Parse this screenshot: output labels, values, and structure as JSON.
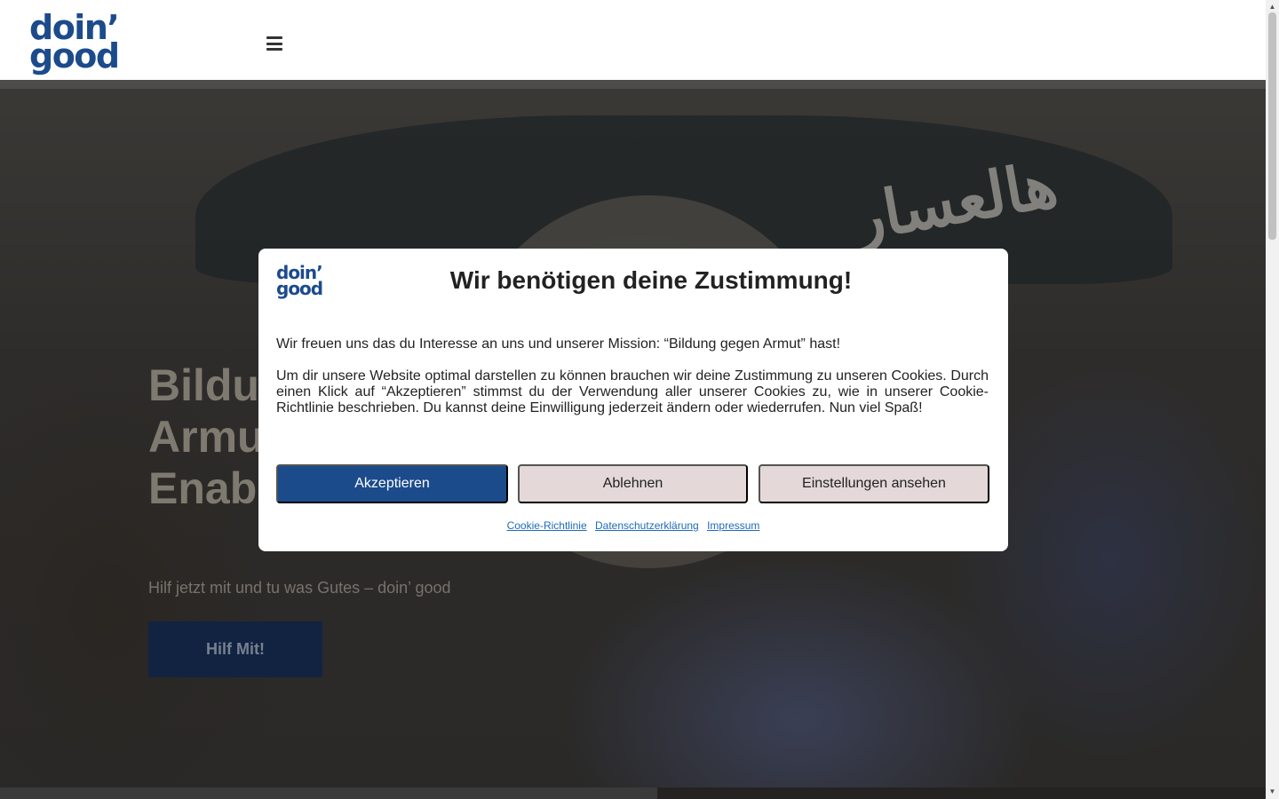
{
  "header": {
    "logo_line1": "doin’",
    "logo_line2": "good",
    "menu_icon": "hamburger-icon"
  },
  "hero": {
    "title": "Bildun\nArmu\nEnabl",
    "subtitle": "Hilf jetzt mit und tu was Gutes – doin’ good",
    "cta_label": "Hilf Mit!",
    "background_text": "هالعسار"
  },
  "consent_modal": {
    "logo_line1": "doin’",
    "logo_line2": "good",
    "title": "Wir benötigen deine Zustimmung!",
    "intro": "Wir freuen uns das du Interesse an uns und unserer Mission: “Bildung gegen Armut” hast!",
    "body": "Um dir unsere Website optimal darstellen zu können brauchen wir deine Zustimmung zu unseren Cookies. Durch einen Klick auf “Akzeptieren” stimmst du der Verwendung aller unserer Cookies zu, wie in unserer Cookie-Richtlinie beschrieben. Du kannst deine Einwilligung jederzeit ändern oder wiederrufen. Nun viel Spaß!",
    "accept_label": "Akzeptieren",
    "deny_label": "Ablehnen",
    "settings_label": "Einstellungen ansehen",
    "links": [
      "Cookie-Richtlinie",
      "Datenschutzerklärung",
      "Impressum"
    ]
  },
  "colors": {
    "brand_blue": "#1c4b8c",
    "secondary_button": "#e4d8d8",
    "link": "#1e6bb8"
  }
}
